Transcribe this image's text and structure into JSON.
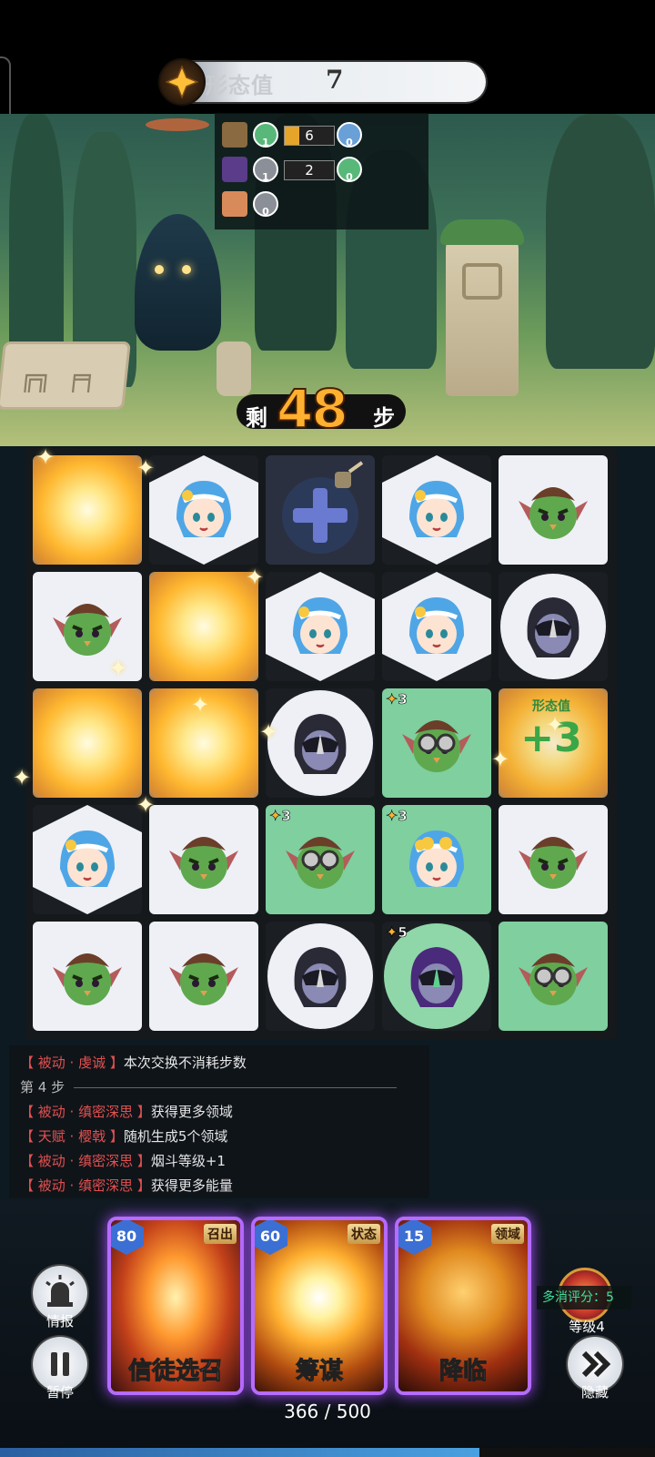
{
  "form_bar": {
    "label": "形态值",
    "value": "7"
  },
  "stats": [
    {
      "count": "6",
      "left_badge": "1",
      "right_badge": "0",
      "fill": 0.3
    },
    {
      "count": "2",
      "left_badge": "1",
      "right_badge": "0",
      "fill": 0.0
    },
    {
      "right_badge": "0"
    }
  ],
  "steps": {
    "prefix": "剩",
    "value": "48",
    "suffix": "步"
  },
  "board": {
    "rows": [
      [
        "burst",
        "girl",
        "bomb",
        "girl",
        "orc"
      ],
      [
        "orc",
        "burst",
        "girl",
        "girl",
        "dark"
      ],
      [
        "burst",
        "burst",
        "dark",
        "orc-goggles",
        "bonus"
      ],
      [
        "girl",
        "orc",
        "orc-goggles",
        "girl-goggles",
        "orc"
      ],
      [
        "orc",
        "orc",
        "dark",
        "dark-horn",
        "orc-goggles"
      ]
    ],
    "tiers": {
      "2-3": "3",
      "3-2": "3",
      "3-3": "3",
      "4-3": "5"
    },
    "bonus": {
      "label": "形态值",
      "value": "+3"
    }
  },
  "log": [
    {
      "tag": "【 被动 · 虔诚 】",
      "text": "本次交换不消耗步数"
    },
    {
      "step": "第 4 步"
    },
    {
      "tag": "【 被动 · 缜密深思 】",
      "text": "获得更多领域"
    },
    {
      "tag": "【 天赋 · 樱戟 】",
      "text": "随机生成5个领域"
    },
    {
      "tag": "【 被动 · 缜密深思 】",
      "text": "烟斗等级+1"
    },
    {
      "tag": "【 被动 · 缜密深思 】",
      "text": "获得更多能量"
    }
  ],
  "controls": {
    "intel_label": "情报",
    "pause_label": "暂停",
    "hide_label": "隐藏",
    "score_label": "多消评分：5",
    "level_label": "等级4"
  },
  "cards": [
    {
      "cost": "80",
      "type": "召出",
      "name": "信徒选召"
    },
    {
      "cost": "60",
      "type": "状态",
      "name": "筹谋"
    },
    {
      "cost": "15",
      "type": "领域",
      "name": "降临"
    }
  ],
  "energy": {
    "text": "366 / 500",
    "current": 366,
    "max": 500
  },
  "colors": {
    "accent_purple": "#b56cff",
    "step_orange": "#ffb030",
    "log_tag_red": "#e25050",
    "green_tile": "#7fcf9f"
  }
}
